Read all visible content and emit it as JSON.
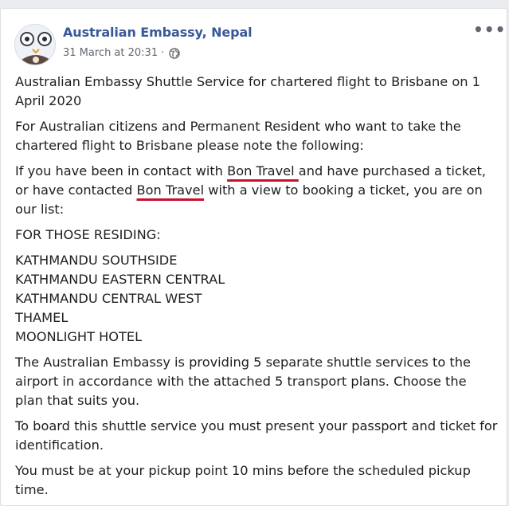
{
  "post": {
    "author": "Australian Embassy, Nepal",
    "timestamp": "31 March at 20:31",
    "separator": "·",
    "visibility_icon": "globe-icon",
    "more_label": "•••"
  },
  "body": {
    "p1": "Australian Embassy Shuttle Service for chartered flight to Brisbane on 1 April 2020",
    "p2": "For Australian citizens and Permanent Resident who want to take the chartered flight to Brisbane please note the following:",
    "p3": {
      "t1": "If you have been in contact with ",
      "link1": "Bon Travel ",
      "t2": "and have purchased a ticket, or have contacted ",
      "link2": "Bon Travel",
      "t3": " with a view to booking a ticket, you are on our list:"
    },
    "p4": "FOR THOSE RESIDING:",
    "locations": [
      "KATHMANDU SOUTHSIDE",
      "KATHMANDU EASTERN CENTRAL",
      "KATHMANDU CENTRAL WEST",
      "THAMEL",
      "MOONLIGHT HOTEL"
    ],
    "p5": "The Australian Embassy is providing 5 separate shuttle services to the airport in accordance with the attached 5 transport plans. Choose the plan that suits you.",
    "p6": "To board this shuttle service you must present your passport and ticket for identification.",
    "p7": "You must be at your pickup point 10 mins before the scheduled pickup time."
  },
  "colors": {
    "author": "#385898",
    "meta": "#616770",
    "text": "#1c1e21",
    "underline_annotation": "#c8102e",
    "background": "#e9ebee"
  }
}
